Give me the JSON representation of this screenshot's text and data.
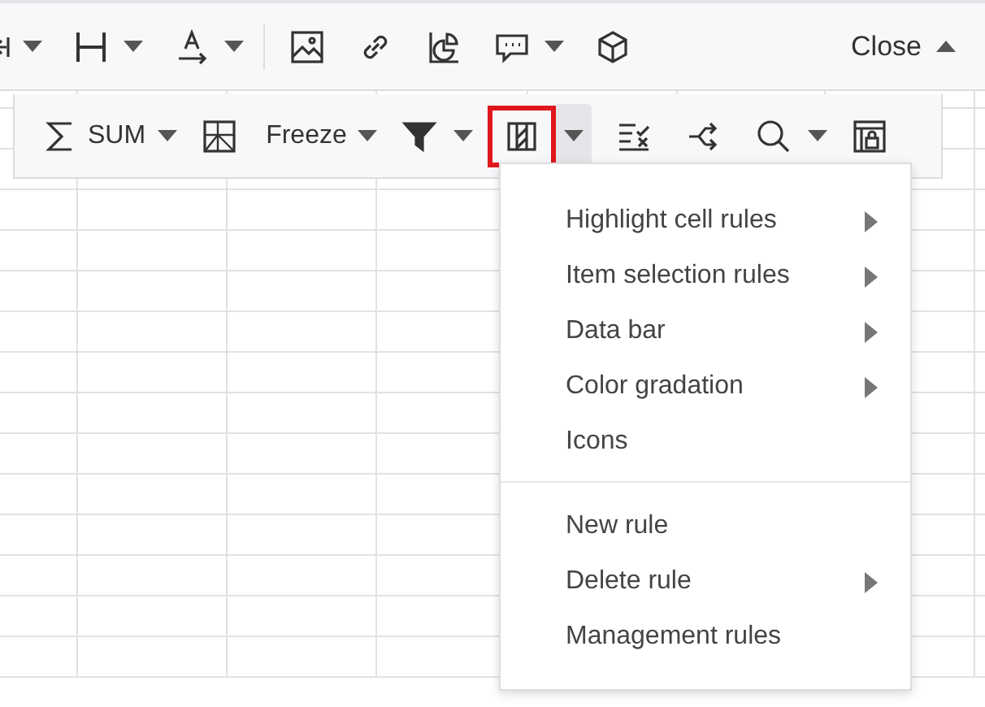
{
  "toolbar": {
    "tools": [
      {
        "dropdown": true
      },
      {
        "dropdown": true
      },
      {
        "dropdown": true
      },
      {
        "dropdown": false
      },
      {
        "dropdown": false
      },
      {
        "dropdown": false
      },
      {
        "dropdown": true
      },
      {
        "dropdown": false
      }
    ],
    "close_button": {
      "label": "Close"
    }
  },
  "toolbar_2": {
    "tools": [
      {
        "label": "SUM",
        "dropdown": true,
        "expanded": false
      },
      {
        "dropdown": false,
        "expanded": false
      },
      {
        "label": "Freeze",
        "dropdown": true,
        "expanded": false
      },
      {
        "dropdown": true,
        "expanded": false
      },
      {
        "dropdown": true,
        "expanded": true
      },
      {
        "dropdown": false,
        "expanded": false
      },
      {
        "dropdown": false,
        "expanded": false
      },
      {
        "dropdown": true,
        "expanded": false
      },
      {
        "dropdown": false,
        "expanded": false
      }
    ]
  },
  "menu": {
    "sections": [
      [
        {
          "label": "Highlight cell rules",
          "submenu": true
        },
        {
          "label": "Item selection rules",
          "submenu": true
        },
        {
          "label": "Data bar",
          "submenu": true
        },
        {
          "label": "Color gradation",
          "submenu": true
        },
        {
          "label": "Icons",
          "submenu": false
        }
      ],
      [
        {
          "label": "New rule",
          "submenu": false
        },
        {
          "label": "Delete rule",
          "submenu": true
        },
        {
          "label": "Management rules",
          "submenu": false
        }
      ]
    ]
  }
}
